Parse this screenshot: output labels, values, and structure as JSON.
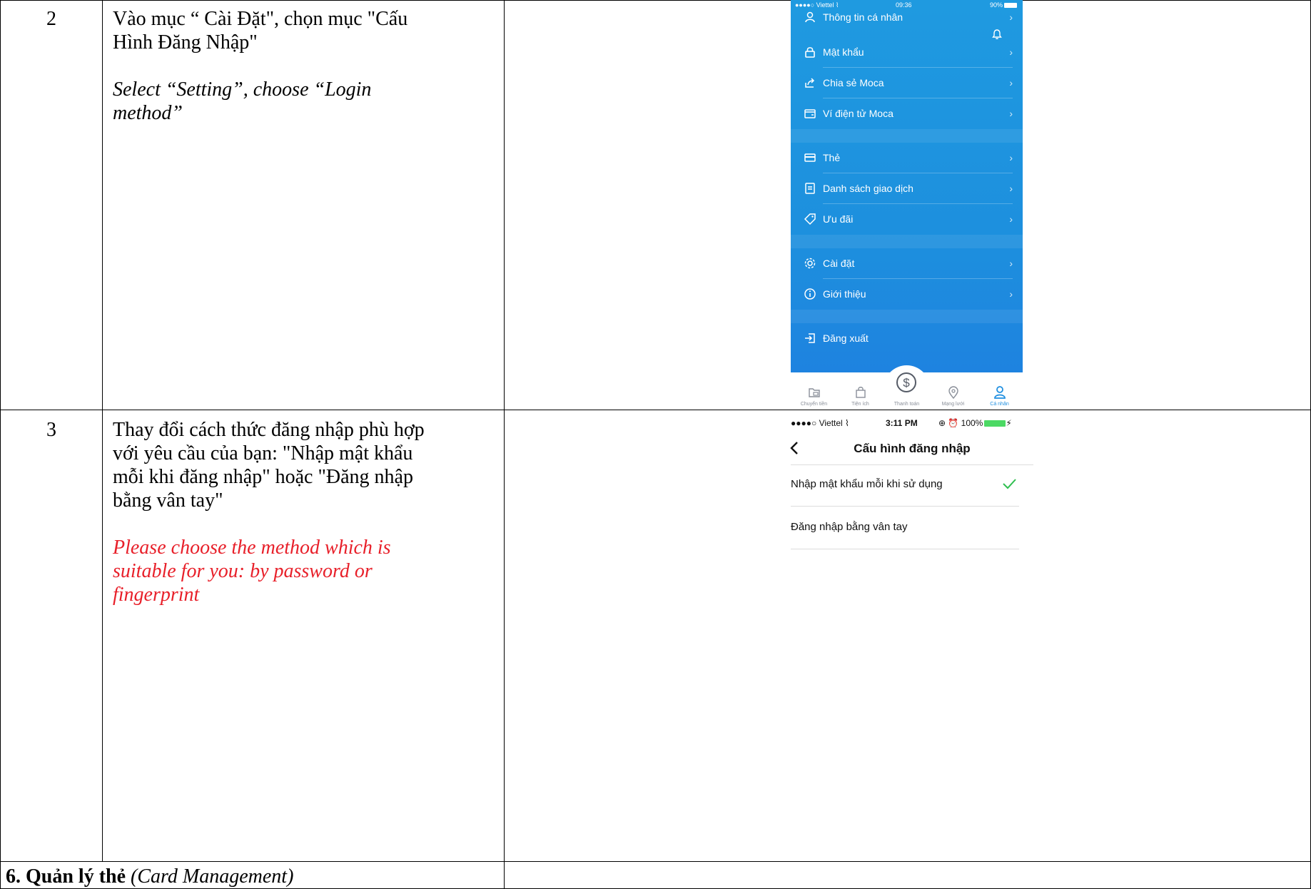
{
  "rows": [
    {
      "number": "2",
      "vi_line1": "Vào mục “ Cài Đặt\", chọn mục \"Cấu",
      "vi_line2": "Hình Đăng Nhập\"",
      "en_line1": "Select “Setting”, choose “Login",
      "en_line2": "method”"
    },
    {
      "number": "3",
      "vi_line1": "Thay đổi cách thức đăng nhập phù hợp",
      "vi_line2": "với yêu cầu của bạn: \"Nhập mật khẩu",
      "vi_line3": "mỗi khi đăng nhập\" hoặc \"Đăng nhập",
      "vi_line4": "bằng vân tay\"",
      "en_line1": "Please choose the method which is",
      "en_line2": "suitable for you: by password or",
      "en_line3": "fingerprint",
      "en_color": "#e8202a"
    }
  ],
  "section": {
    "title_bold": "6. Quản lý thẻ",
    "title_italic": "(Card Management)"
  },
  "phone1": {
    "status": {
      "carrier": "●●●●○ Viettel ⌇",
      "time": "09:36",
      "battery": "90%"
    },
    "menu": [
      {
        "label": "Thông tin cá nhân",
        "icon": "person-icon"
      },
      {
        "label": "Mật khẩu",
        "icon": "lock-icon"
      },
      {
        "label": "Chia sẻ Moca",
        "icon": "share-icon"
      },
      {
        "label": "Ví điện tử Moca",
        "icon": "wallet-icon"
      },
      {
        "label": "Thẻ",
        "icon": "card-icon"
      },
      {
        "label": "Danh sách giao dịch",
        "icon": "list-icon"
      },
      {
        "label": "Ưu đãi",
        "icon": "tag-icon"
      },
      {
        "label": "Cài đặt",
        "icon": "gear-icon"
      },
      {
        "label": "Giới thiệu",
        "icon": "info-icon"
      },
      {
        "label": "Đăng xuất",
        "icon": "logout-icon"
      }
    ],
    "tabs": [
      {
        "label": "Chuyển tiền",
        "icon": "transfer-icon"
      },
      {
        "label": "Tiện ích",
        "icon": "bag-icon"
      },
      {
        "label": "Thanh toán",
        "icon": "dollar-icon"
      },
      {
        "label": "Mạng lưới",
        "icon": "location-icon"
      },
      {
        "label": "Cá nhân",
        "icon": "person-icon",
        "active": true
      }
    ]
  },
  "phone2": {
    "status": {
      "carrier": "●●●●○ Viettel ⌇",
      "time": "3:11 PM",
      "right": "⊕ ⏰ 100%"
    },
    "title": "Cấu hình đăng nhập",
    "options": [
      {
        "label": "Nhập mật khẩu mỗi khi sử dụng",
        "selected": true
      },
      {
        "label": "Đăng nhập bằng vân tay",
        "selected": false
      }
    ],
    "check_color": "#2fbf4f"
  }
}
